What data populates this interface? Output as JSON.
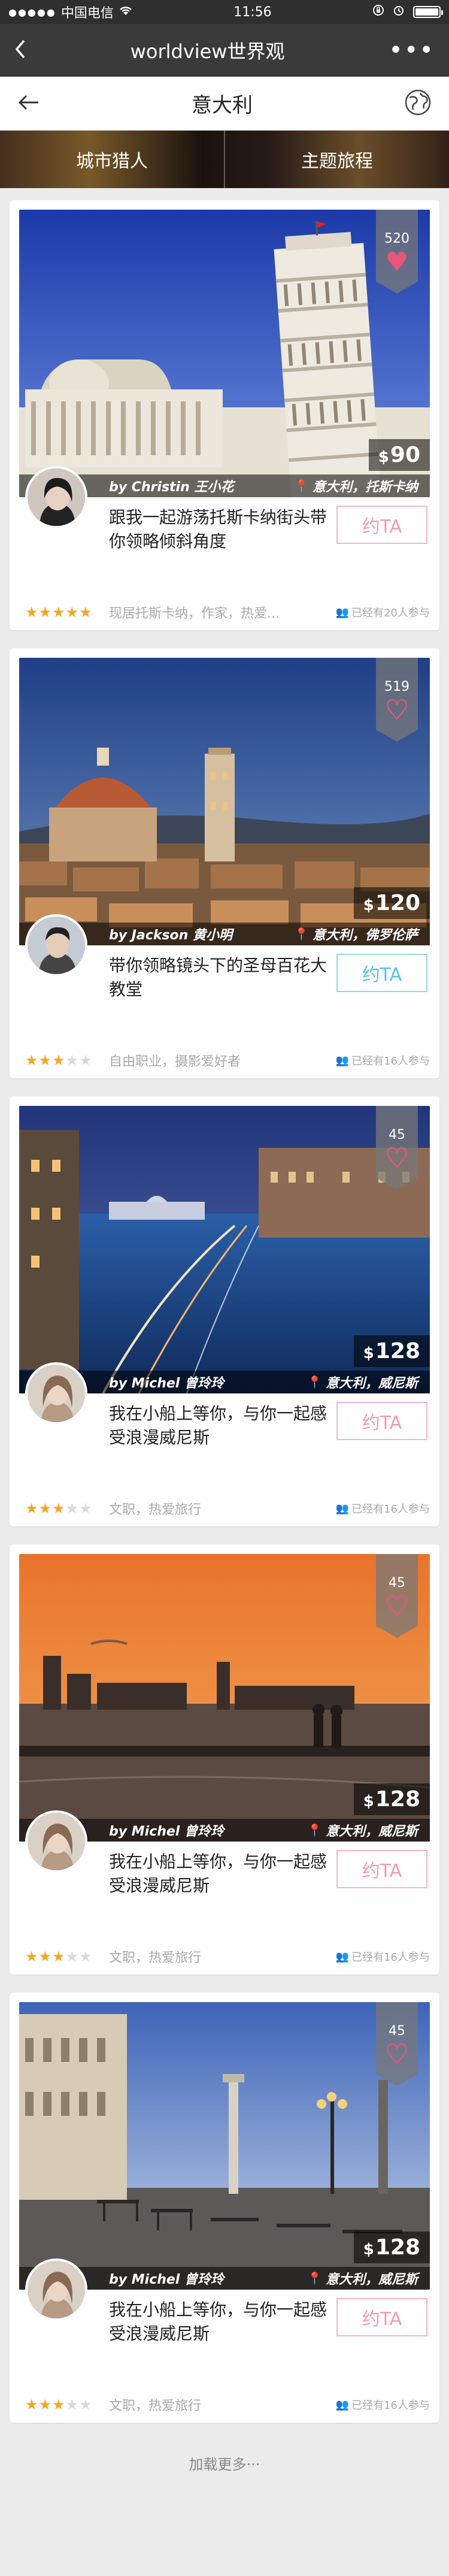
{
  "status_bar": {
    "carrier": "中国电信",
    "time": "11:56"
  },
  "nav": {
    "title": "worldview世界观",
    "back_icon": "chevron-left-icon",
    "more_icon": "more-dots-icon"
  },
  "page": {
    "title": "意大利",
    "back_icon": "arrow-left-icon",
    "globe_icon": "globe-icon"
  },
  "tabs": [
    {
      "label": "城市猎人",
      "active": true
    },
    {
      "label": "主题旅程",
      "active": false
    }
  ],
  "cards": [
    {
      "likes": "520",
      "liked": true,
      "price": "90",
      "author": "by  Christin 王小花",
      "location": "意大利，托斯卡纳",
      "title": "跟我一起游荡托斯卡纳街头带你领略倾斜角度",
      "stars": 5,
      "tags": "现居托斯卡纳，作家，热爱...",
      "joined": "已经有20人参与",
      "contact_label": "约TA",
      "contact_style": "pink"
    },
    {
      "likes": "519",
      "liked": false,
      "price": "120",
      "author": "by  Jackson 黄小明",
      "location": "意大利，佛罗伦萨",
      "title": "带你领略镜头下的圣母百花大教堂",
      "stars": 3,
      "tags": "自由职业，摄影爱好者",
      "joined": "已经有16人参与",
      "contact_label": "约TA",
      "contact_style": "blue"
    },
    {
      "likes": "45",
      "liked": false,
      "price": "128",
      "author": "by  Michel 曾玲玲",
      "location": "意大利，威尼斯",
      "title": "我在小船上等你，与你一起感受浪漫威尼斯",
      "stars": 3,
      "tags": "文职，热爱旅行",
      "joined": "已经有16人参与",
      "contact_label": "约TA",
      "contact_style": "pink"
    },
    {
      "likes": "45",
      "liked": false,
      "price": "128",
      "author": "by  Michel 曾玲玲",
      "location": "意大利，威尼斯",
      "title": "我在小船上等你，与你一起感受浪漫威尼斯",
      "stars": 3,
      "tags": "文职，热爱旅行",
      "joined": "已经有16人参与",
      "contact_label": "约TA",
      "contact_style": "pink"
    },
    {
      "likes": "45",
      "liked": false,
      "price": "128",
      "author": "by  Michel 曾玲玲",
      "location": "意大利，威尼斯",
      "title": "我在小船上等你，与你一起感受浪漫威尼斯",
      "stars": 3,
      "tags": "文职，热爱旅行",
      "joined": "已经有16人参与",
      "contact_label": "约TA",
      "contact_style": "pink"
    }
  ],
  "currency_symbol": "$",
  "load_more": "加载更多···"
}
